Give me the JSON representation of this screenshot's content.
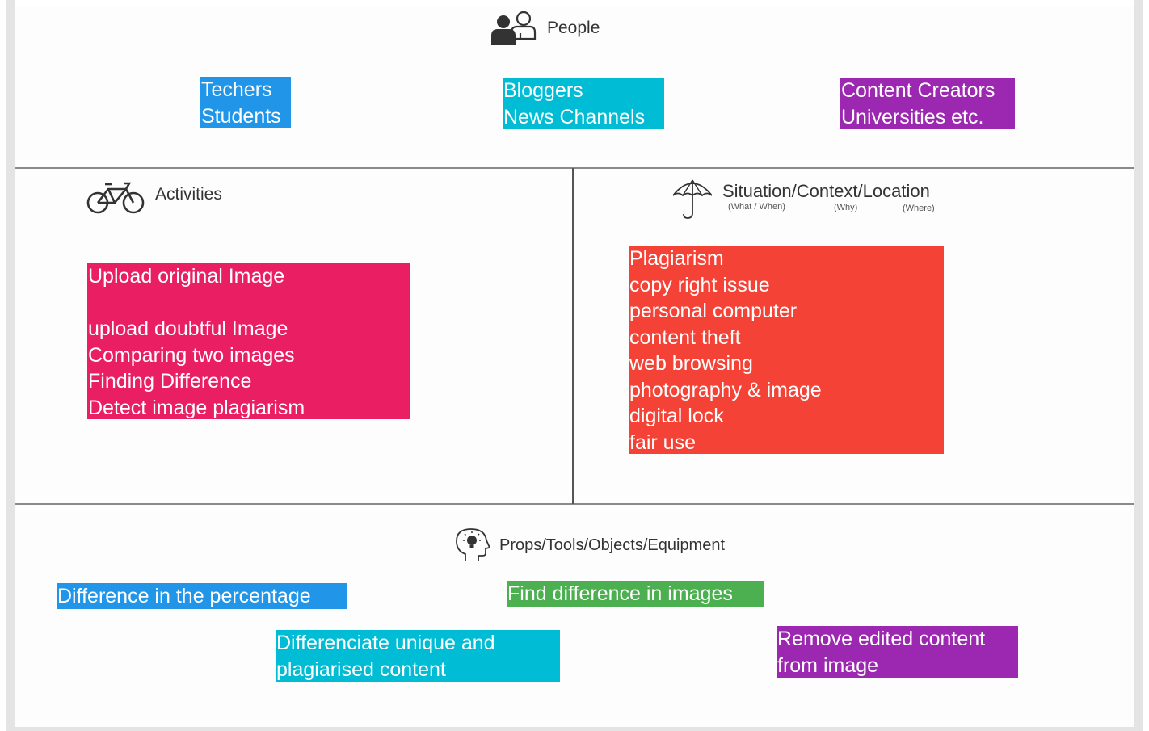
{
  "sections": {
    "people": {
      "title": "People",
      "notes": [
        {
          "lines": [
            "Techers",
            "Students"
          ],
          "color": "#2196e8"
        },
        {
          "lines": [
            "Bloggers",
            "News Channels"
          ],
          "color": "#00bcd4"
        },
        {
          "lines": [
            "Content Creators",
            "Universities etc."
          ],
          "color": "#9c27b0"
        }
      ]
    },
    "activities": {
      "title": "Activities",
      "note": {
        "lines": [
          "Upload original Image",
          "",
          "upload doubtful Image",
          "Comparing two images",
          "Finding Difference",
          "Detect image plagiarism"
        ],
        "color": "#e91e63"
      }
    },
    "situation": {
      "title": "Situation/Context/Location",
      "subtitles": [
        "(What / When)",
        "(Why)",
        "(Where)"
      ],
      "note": {
        "lines": [
          "Plagiarism",
          "copy right issue",
          "personal computer",
          "content theft",
          "web browsing",
          "photography & image",
          "digital lock",
          "fair use"
        ],
        "color": "#f44336"
      }
    },
    "props": {
      "title": "Props/Tools/Objects/Equipment",
      "notes": [
        {
          "lines": [
            "Difference in the percentage"
          ],
          "color": "#2196e8"
        },
        {
          "lines": [
            "Find difference in images"
          ],
          "color": "#4caf50"
        },
        {
          "lines": [
            "Differenciate unique and",
            "plagiarised content"
          ],
          "color": "#00bcd4"
        },
        {
          "lines": [
            "Remove edited content",
            "from image"
          ],
          "color": "#9c27b0"
        }
      ]
    }
  },
  "icons": {
    "people": "people-icon",
    "activities": "bicycle-icon",
    "situation": "umbrella-icon",
    "props": "idea-head-icon"
  }
}
